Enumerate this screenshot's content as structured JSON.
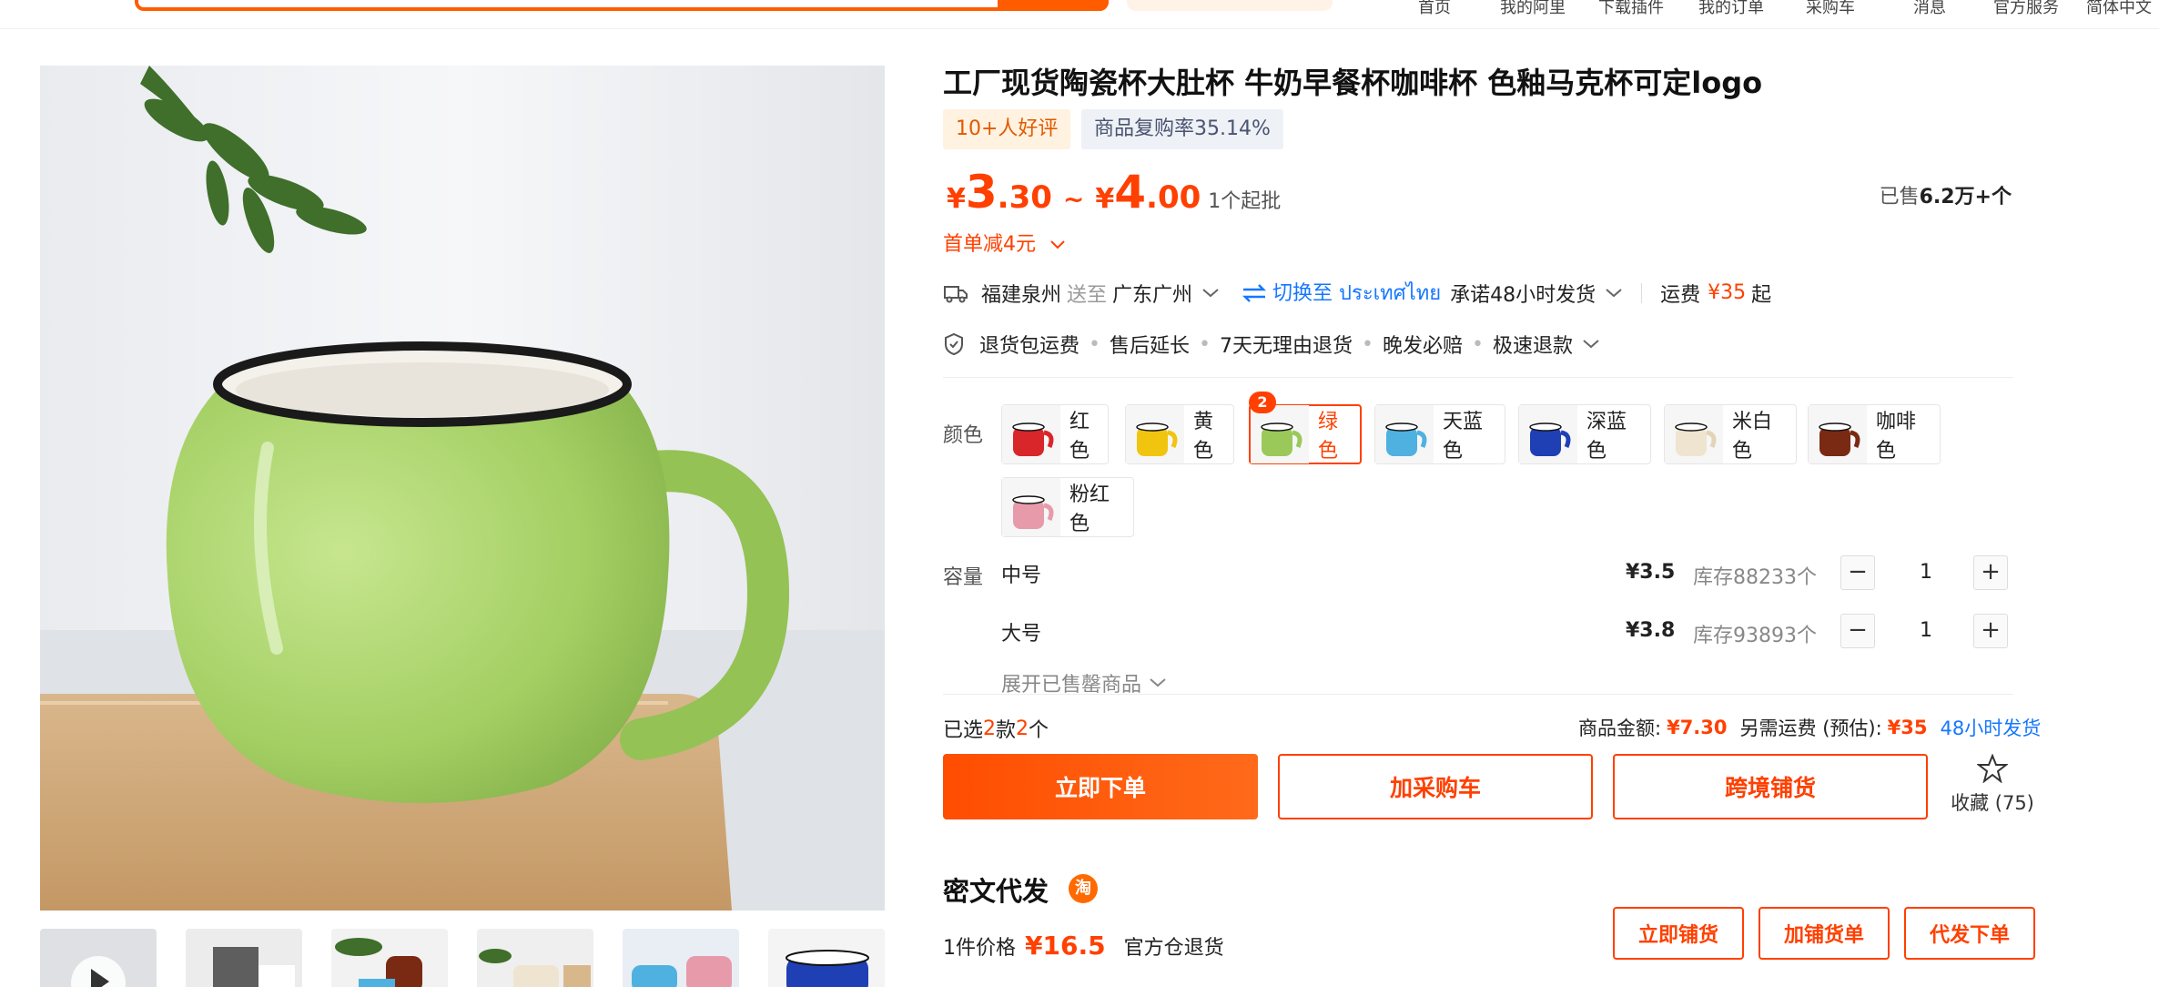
{
  "header": {
    "nav": [
      "首页",
      "我的阿里",
      "下载插件",
      "我的订单",
      "采购车",
      "消息",
      "官方服务",
      "简体中文"
    ]
  },
  "product": {
    "title": "工厂现货陶瓷杯大肚杯 牛奶早餐杯咖啡杯 色釉马克杯可定logo",
    "badge_good": "10+人好评",
    "badge_rebuy": "商品复购率35.14%",
    "price_symbol": "¥",
    "price_low_int": "3",
    "price_low_dec": ".30",
    "price_tilde": "~",
    "price_high_int": "4",
    "price_high_dec": ".00",
    "min_order": "1个起批",
    "sold_prefix": "已售",
    "sold_value": "6.2万+个",
    "coupon": "首单减4元"
  },
  "shipping": {
    "origin": "福建泉州",
    "to_label": "送至",
    "destination": "广东广州",
    "switch_text": "切换至 ประเทศไทย",
    "promise": "承诺48小时发货",
    "fee_label": "运费",
    "fee_value": "¥35",
    "fee_suffix": "起"
  },
  "services": [
    "退货包运费",
    "售后延长",
    "7天无理由退货",
    "晚发必赔",
    "极速退款"
  ],
  "color": {
    "label": "颜色",
    "selected_count": "2",
    "options": [
      {
        "name": "红色",
        "swatch": "#d8262a"
      },
      {
        "name": "黄色",
        "swatch": "#f1c40f"
      },
      {
        "name": "绿色",
        "swatch": "#9ac95a"
      },
      {
        "name": "天蓝色",
        "swatch": "#4fb1e0"
      },
      {
        "name": "深蓝色",
        "swatch": "#1f3fb5"
      },
      {
        "name": "米白色",
        "swatch": "#efe4cf"
      },
      {
        "name": "咖啡色",
        "swatch": "#7a2a12"
      },
      {
        "name": "粉红色",
        "swatch": "#e79aaa"
      }
    ]
  },
  "capacity": {
    "label": "容量",
    "rows": [
      {
        "name": "中号",
        "price": "¥3.5",
        "stock": "库存88233个",
        "qty": "1"
      },
      {
        "name": "大号",
        "price": "¥3.8",
        "stock": "库存93893个",
        "qty": "1"
      }
    ],
    "expand": "展开已售罄商品"
  },
  "summary": {
    "selected_prefix": "已选",
    "selected_kinds": "2",
    "selected_mid": "款",
    "selected_items": "2",
    "selected_suffix": "个",
    "amount_label": "商品金额:",
    "amount_value": "¥7.30",
    "extra_label": "另需运费 (预估):",
    "extra_value": "¥35",
    "ship_note": "48小时发货"
  },
  "actions": {
    "buy_now": "立即下单",
    "add_cart": "加采购车",
    "cross_border": "跨境铺货",
    "favorite_label": "收藏 (75)"
  },
  "dropship": {
    "title": "密文代发",
    "logo_text": "淘",
    "price_label": "1件价格",
    "price_value": "¥16.5",
    "return_note": "官方仓退货",
    "btn_list": "立即铺货",
    "btn_add": "加铺货单",
    "btn_order": "代发下单"
  },
  "colors": {
    "accent": "#ff4000",
    "link": "#1677ff"
  }
}
